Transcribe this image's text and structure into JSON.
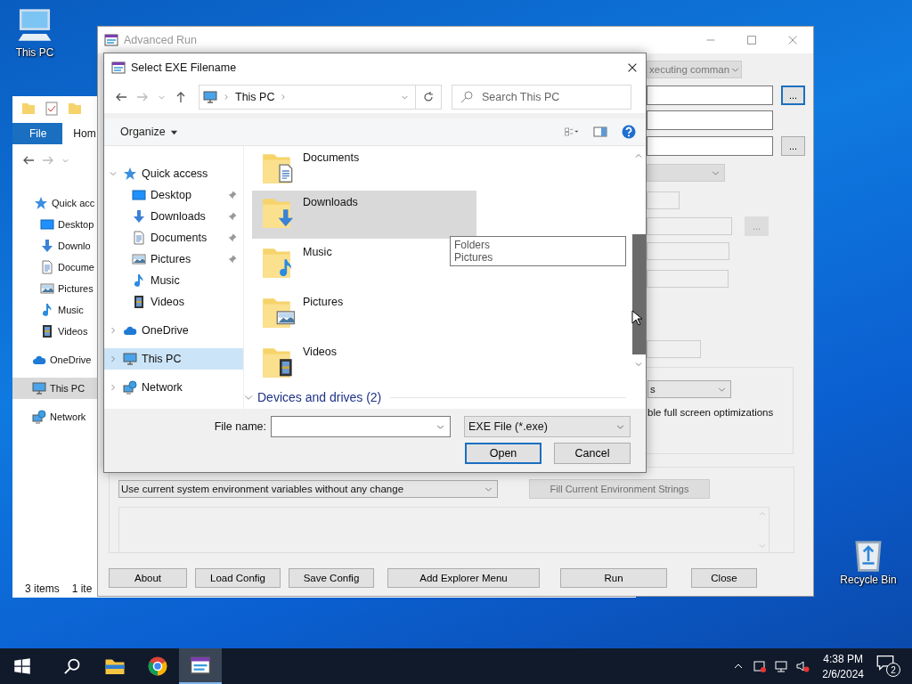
{
  "desktop": {
    "icons": [
      {
        "label": "This PC",
        "kind": "pc"
      },
      {
        "label": "Recycle Bin",
        "kind": "bin"
      }
    ]
  },
  "explorer_window": {
    "ribbon_tabs": [
      {
        "label": "File",
        "kind": "file_menu"
      },
      {
        "label": "Hom",
        "kind": "tab"
      }
    ],
    "nav_items": [
      {
        "label": "Quick acc",
        "kind": "star",
        "selected": false
      },
      {
        "label": "Desktop",
        "kind": "desktop",
        "selected": false
      },
      {
        "label": "Downlo",
        "kind": "download",
        "selected": false
      },
      {
        "label": "Docume",
        "kind": "document",
        "selected": false
      },
      {
        "label": "Pictures",
        "kind": "pictures",
        "selected": false
      },
      {
        "label": "Music",
        "kind": "music",
        "selected": false
      },
      {
        "label": "Videos",
        "kind": "videos",
        "selected": false
      },
      {
        "label": "OneDrive",
        "kind": "cloud",
        "selected": false
      },
      {
        "label": "This PC",
        "kind": "pc",
        "selected": true
      },
      {
        "label": "Network",
        "kind": "network",
        "selected": false
      }
    ],
    "status_bar": [
      "3 items",
      "1 ite"
    ]
  },
  "advanced_run": {
    "title": "Advanced Run",
    "form_rows": [
      {
        "kind": "combo",
        "value": "xecuting comman",
        "disabled": true
      },
      {
        "kind": "input",
        "disabled": false,
        "browse": {
          "label": "...",
          "focused": true,
          "disabled": false
        }
      },
      {
        "kind": "input",
        "disabled": false
      },
      {
        "kind": "input",
        "disabled": false,
        "browse": {
          "label": "...",
          "focused": false,
          "disabled": false
        }
      },
      {
        "kind": "combo",
        "disabled": true
      },
      {
        "kind": "input",
        "disabled": true
      },
      {
        "kind": "input",
        "disabled": true,
        "browse": {
          "label": "...",
          "focused": false,
          "disabled": true
        }
      },
      {
        "kind": "input",
        "disabled": true
      },
      {
        "kind": "input",
        "disabled": true
      },
      {
        "kind": "input",
        "disabled": true
      }
    ],
    "options_group": {
      "combo": "s",
      "checkbox_label": "ble full screen optimizations"
    },
    "environment": {
      "combo": "Use current system environment variables without any change",
      "fill_button": {
        "label": "Fill Current Environment Strings",
        "disabled": true
      }
    },
    "buttons": [
      "About",
      "Load Config",
      "Save Config",
      "Add Explorer Menu",
      "Run",
      "Close"
    ]
  },
  "file_dialog": {
    "title": "Select EXE Filename",
    "address": [
      "This PC"
    ],
    "search": {
      "placeholder": "Search This PC"
    },
    "organize": "Organize",
    "nav_tree": [
      {
        "label": "Quick access",
        "kind": "star",
        "expanded": true,
        "selected": false,
        "children": [
          {
            "label": "Desktop",
            "kind": "desktop",
            "pinned": true,
            "selected": false
          },
          {
            "label": "Downloads",
            "kind": "download",
            "pinned": true,
            "selected": false
          },
          {
            "label": "Documents",
            "kind": "document",
            "pinned": true,
            "selected": false
          },
          {
            "label": "Pictures",
            "kind": "pictures",
            "pinned": true,
            "selected": false
          },
          {
            "label": "Music",
            "kind": "music",
            "pinned": false,
            "selected": false
          },
          {
            "label": "Videos",
            "kind": "videos",
            "pinned": false,
            "selected": false
          }
        ]
      },
      {
        "label": "OneDrive",
        "kind": "cloud",
        "expanded": false,
        "selected": false
      },
      {
        "label": "This PC",
        "kind": "pc",
        "expanded": false,
        "selected": true
      },
      {
        "label": "Network",
        "kind": "network",
        "expanded": false,
        "selected": false
      }
    ],
    "folders": [
      {
        "name": "Documents",
        "kind": "document",
        "selected": false
      },
      {
        "name": "Downloads",
        "kind": "download",
        "selected": true
      },
      {
        "name": "Music",
        "kind": "music",
        "selected": false
      },
      {
        "name": "Pictures",
        "kind": "pictures",
        "selected": false
      },
      {
        "name": "Videos",
        "kind": "videos",
        "selected": false
      }
    ],
    "tooltip": [
      "Folders",
      "Pictures"
    ],
    "group_header": "Devices and drives (2)",
    "file_name_label": "File name:",
    "file_type": "EXE File (*.exe)",
    "buttons": [
      {
        "label": "Open",
        "default": true
      },
      {
        "label": "Cancel",
        "default": false
      }
    ]
  },
  "taskbar": {
    "apps": [
      {
        "kind": "explorer",
        "active": false
      },
      {
        "kind": "chrome",
        "active": false
      },
      {
        "kind": "advrun",
        "active": true
      }
    ],
    "time": "4:38 PM",
    "date": "2/6/2024",
    "notifications": "2"
  }
}
